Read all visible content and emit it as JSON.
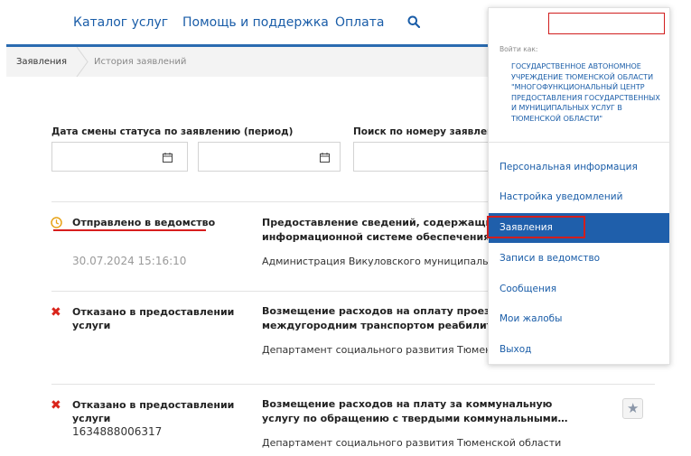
{
  "nav": {
    "catalog": "Каталог услуг",
    "help": "Помощь и поддержка",
    "payment": "Оплата"
  },
  "breadcrumb": [
    "Заявления",
    "История заявлений"
  ],
  "filters": {
    "date_label": "Дата смены статуса по заявлению (период)",
    "search_label": "Поиск по номеру заявления"
  },
  "applications": [
    {
      "status": "Отправлено в ведомство",
      "status_icon": "clock-icon",
      "date": "30.07.2024 15:16:10",
      "title_lines": [
        "Предоставление сведений, содержащихся в",
        "информационной системе обеспечения…"
      ],
      "department": "Администрация Викуловского муниципального р"
    },
    {
      "status_lines": [
        "Отказано в предоставлении",
        "услуги"
      ],
      "status_icon": "reject-icon",
      "title_lines": [
        "Возмещение расходов на оплату проезда",
        "междугородним транспортом реабилитирова"
      ],
      "department": "Департамент социального развития Тюменской о"
    },
    {
      "status_lines": [
        "Отказано в предоставлении",
        "услуги"
      ],
      "status_icon": "reject-icon",
      "number": "1634888006317",
      "title_lines": [
        "Возмещение расходов на плату за коммунальную",
        "услугу по обращению с твердыми коммунальными…"
      ],
      "department": "Департамент социального развития Тюменской области"
    }
  ],
  "dropdown": {
    "login_label": "Войти как:",
    "org_lines": [
      "ГОСУДАРСТВЕННОЕ АВТОНОМНОЕ",
      "УЧРЕЖДЕНИЕ ТЮМЕНСКОЙ ОБЛАСТИ",
      "\"МНОГОФУНКЦИОНАЛЬНЫЙ ЦЕНТР",
      "ПРЕДОСТАВЛЕНИЯ ГОСУДАРСТВЕННЫХ",
      "И МУНИЦИПАЛЬНЫХ УСЛУГ В",
      "ТЮМЕНСКОЙ ОБЛАСТИ\""
    ],
    "items": [
      "Персональная информация",
      "Настройка уведомлений",
      "Заявления",
      "Записи в ведомство",
      "Сообщения",
      "Мои жалобы",
      "Выход"
    ],
    "active_index": 2
  },
  "colors": {
    "brand": "#1a5da8",
    "active": "#1f5fab",
    "highlight": "#d11e1e",
    "reject": "#d9241b",
    "pending": "#e8a317"
  }
}
